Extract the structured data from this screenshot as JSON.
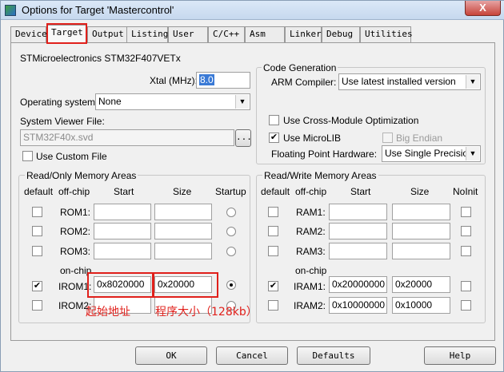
{
  "window": {
    "title": "Options for Target 'Mastercontrol'",
    "close": "X"
  },
  "tabs": [
    "Device",
    "Target",
    "Output",
    "Listing",
    "User",
    "C/C++",
    "Asm",
    "Linker",
    "Debug",
    "Utilities"
  ],
  "target": {
    "device_name": "STMicroelectronics STM32F407VETx",
    "xtal_label": "Xtal (MHz):",
    "xtal_value": "8.0",
    "os_label": "Operating system:",
    "os_value": "None",
    "sv_label": "System Viewer File:",
    "sv_value": "STM32F40x.svd",
    "sv_browse": "...",
    "custom_file_label": "Use Custom File"
  },
  "codegen": {
    "title": "Code Generation",
    "compiler_label": "ARM Compiler:",
    "compiler_value": "Use latest installed version",
    "cross_module": "Use Cross-Module Optimization",
    "microlib": "Use MicroLIB",
    "big_endian": "Big Endian",
    "fp_label": "Floating Point Hardware:",
    "fp_value": "Use Single Precision"
  },
  "rom": {
    "title": "Read/Only Memory Areas",
    "headers": {
      "default": "default",
      "offchip": "off-chip",
      "start": "Start",
      "size": "Size",
      "startup": "Startup"
    },
    "onchip_label": "on-chip",
    "rows": [
      {
        "name": "ROM1:",
        "start": "",
        "size": ""
      },
      {
        "name": "ROM2:",
        "start": "",
        "size": ""
      },
      {
        "name": "ROM3:",
        "start": "",
        "size": ""
      },
      {
        "name": "IROM1:",
        "start": "0x8020000",
        "size": "0x20000"
      },
      {
        "name": "IROM2:",
        "start": "",
        "size": ""
      }
    ]
  },
  "ram": {
    "title": "Read/Write Memory Areas",
    "headers": {
      "default": "default",
      "offchip": "off-chip",
      "start": "Start",
      "size": "Size",
      "noinit": "NoInit"
    },
    "onchip_label": "on-chip",
    "rows": [
      {
        "name": "RAM1:",
        "start": "",
        "size": ""
      },
      {
        "name": "RAM2:",
        "start": "",
        "size": ""
      },
      {
        "name": "RAM3:",
        "start": "",
        "size": ""
      },
      {
        "name": "IRAM1:",
        "start": "0x20000000",
        "size": "0x20000"
      },
      {
        "name": "IRAM2:",
        "start": "0x10000000",
        "size": "0x10000"
      }
    ]
  },
  "annotations": {
    "start_addr": "起始地址",
    "program_size": "程序大小（128kb）"
  },
  "buttons": {
    "ok": "OK",
    "cancel": "Cancel",
    "defaults": "Defaults",
    "help": "Help"
  },
  "colors": {
    "annotation_red": "#e0201b",
    "titlebar": "#c6d8ee"
  }
}
